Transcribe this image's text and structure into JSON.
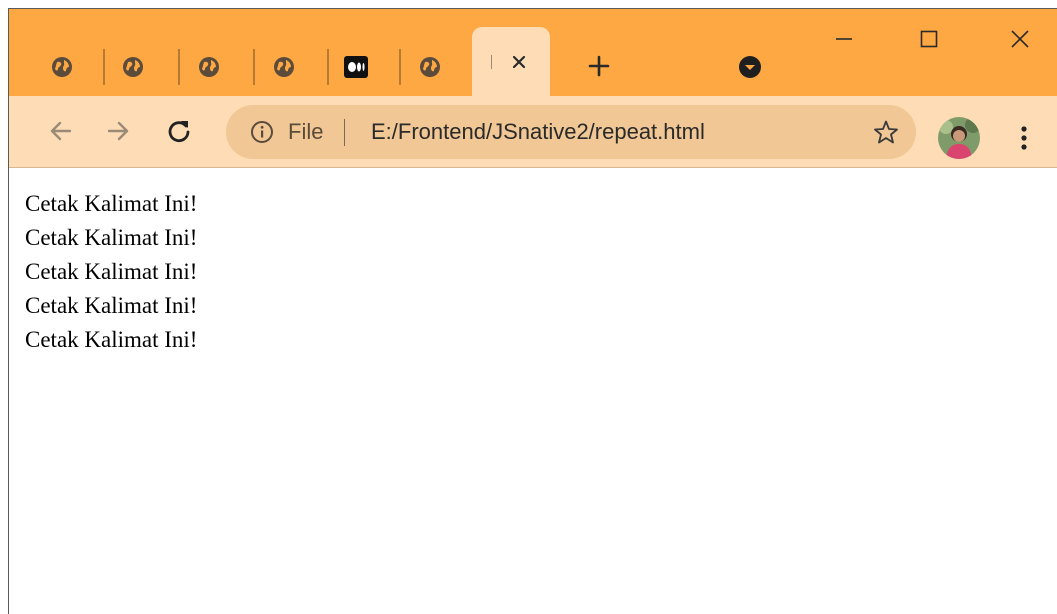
{
  "browser": {
    "tabs": [
      {
        "icon": "globe-icon",
        "active": false
      },
      {
        "icon": "globe-icon",
        "active": false
      },
      {
        "icon": "globe-icon",
        "active": false
      },
      {
        "icon": "globe-icon",
        "active": false
      },
      {
        "icon": "medium-logo-icon",
        "active": false
      },
      {
        "icon": "globe-icon",
        "active": false
      },
      {
        "icon": "close-icon",
        "active": true
      }
    ],
    "new_tab_icon": "plus-icon",
    "tab_search_icon": "chevron-down-icon",
    "window_controls": [
      "minimize-icon",
      "maximize-icon",
      "close-icon"
    ]
  },
  "toolbar": {
    "back_icon": "arrow-left-icon",
    "forward_icon": "arrow-right-icon",
    "reload_icon": "reload-icon",
    "site_info_icon": "info-icon",
    "scheme_label": "File",
    "url": "E:/Frontend/JSnative2/repeat.html",
    "bookmark_icon": "star-icon",
    "menu_icon": "kebab-menu-icon"
  },
  "page": {
    "lines": [
      "Cetak Kalimat Ini!",
      "Cetak Kalimat Ini!",
      "Cetak Kalimat Ini!",
      "Cetak Kalimat Ini!",
      "Cetak Kalimat Ini!"
    ]
  },
  "colors": {
    "tabstrip": "#fea843",
    "toolbar": "#fedcb5",
    "omnibox": "#f0c795",
    "icon": "#5b4b3b"
  }
}
